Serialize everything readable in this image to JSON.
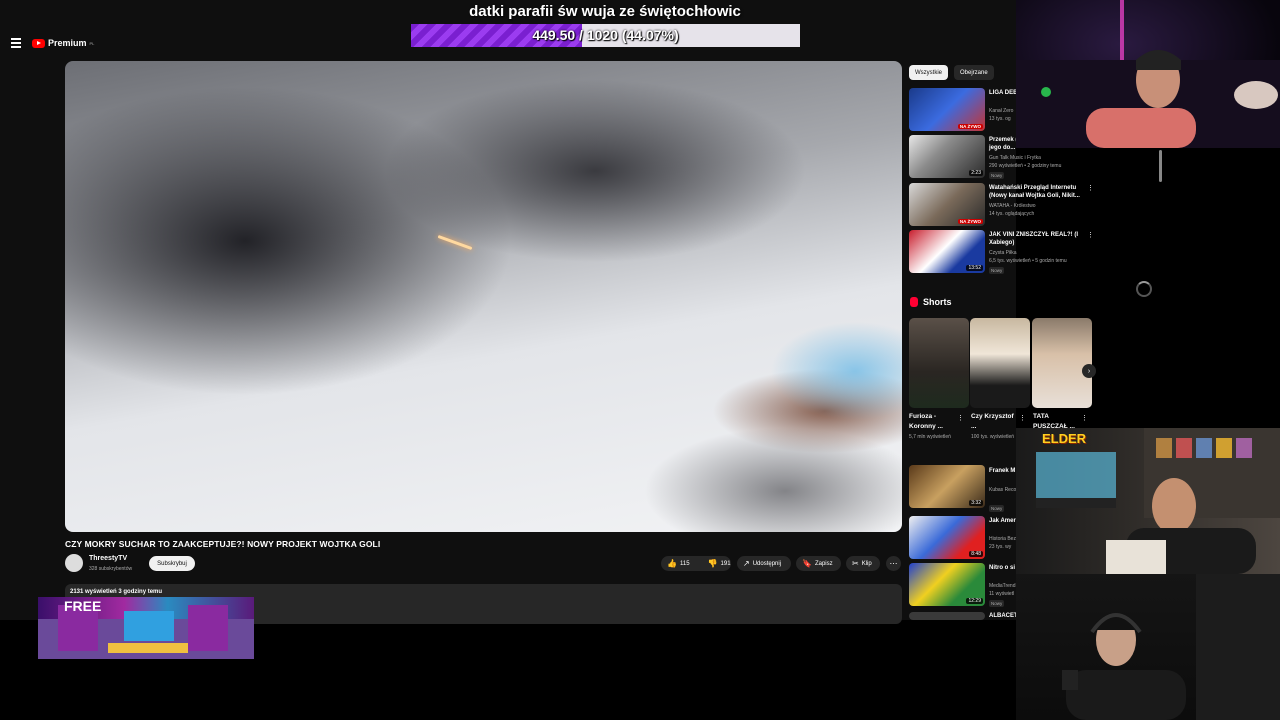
{
  "donation": {
    "title": "datki parafii św wuja ze świętochłowic",
    "progress_text": "449.50 / 1020 (44.07%)",
    "progress_percent": 44.07,
    "fill_color": "#8a2be2"
  },
  "youtube": {
    "logo_text": "Premium",
    "logo_region": "PL",
    "video": {
      "title": "CZY MOKRY SUCHAR TO ZAAKCEPTUJE?! NOWY PROJEKT WOJTKA GOLI",
      "channel_name": "ThreestyTV",
      "channel_subs": "328 subskrybentów",
      "subscribe_label": "Subskrybuj",
      "likes": "115",
      "dislikes": "191",
      "share_label": "Udostępnij",
      "save_label": "Zapisz",
      "clip_label": "Klip",
      "more_icon": "more-horizontal-icon",
      "stats": "2131 wyświetleń  3 godziny temu"
    },
    "chips": [
      "Wszystkie",
      "Obejrzane"
    ],
    "recommendations": [
      {
        "title": "LIGA DEB ZEMBACZ",
        "meta1": "Kanał Zero",
        "meta2": "13 tys. og",
        "badge": "NA ŻYWO",
        "new": ""
      },
      {
        "title": "Przemek (Double F) nie mózg jego do...",
        "meta1": "Gun Talk Music i Frytka",
        "meta2": "290 wyświetleń • 2 godziny temu",
        "badge": "2:23",
        "new": "Nowy"
      },
      {
        "title": "Watahański Przegląd Internetu (Nowy kanał Wojtka Goli, Nikit...",
        "meta1": "WATAHA - Królestwo",
        "meta2": "14 tys. oglądających",
        "badge": "NA ŻYWO",
        "new": ""
      },
      {
        "title": "JAK VINI ZNISZCZYŁ REAL?! (I Xabiego)",
        "meta1": "Czysta Piłka",
        "meta2": "6,5 tys. wyświetleń • 5 godzin temu",
        "badge": "13:52",
        "new": "Nowy"
      }
    ],
    "shorts_label": "Shorts",
    "shorts": [
      {
        "title": "Furioza - Koronny ...",
        "views": "5,7 mln wyświetleń"
      },
      {
        "title": "Czy Krzysztof ...",
        "views": "100 tys. wyświetleń"
      },
      {
        "title": "TATA PUSZCZAŁ ...",
        "views": ""
      }
    ],
    "recommendations2": [
      {
        "title": "Franek M (prod. K. F",
        "meta1": "Kubas Reco",
        "meta2": "",
        "badge": "3:32",
        "new": "Nowy"
      },
      {
        "title": "Jak Amer Bin Laden",
        "meta1": "Historia Bez",
        "meta2": "23 tys. wy",
        "badge": "8:48",
        "new": ""
      },
      {
        "title": "Nitro o si jego proj",
        "meta1": "MediaTrend",
        "meta2": "11 wyświetl",
        "badge": "12:29",
        "new": "Nowy"
      },
      {
        "title": "ALBACET",
        "meta1": "",
        "meta2": "",
        "badge": "",
        "new": ""
      }
    ]
  },
  "overlay": {
    "bottom_text": "FREE",
    "cam_logo": "ELDER"
  }
}
